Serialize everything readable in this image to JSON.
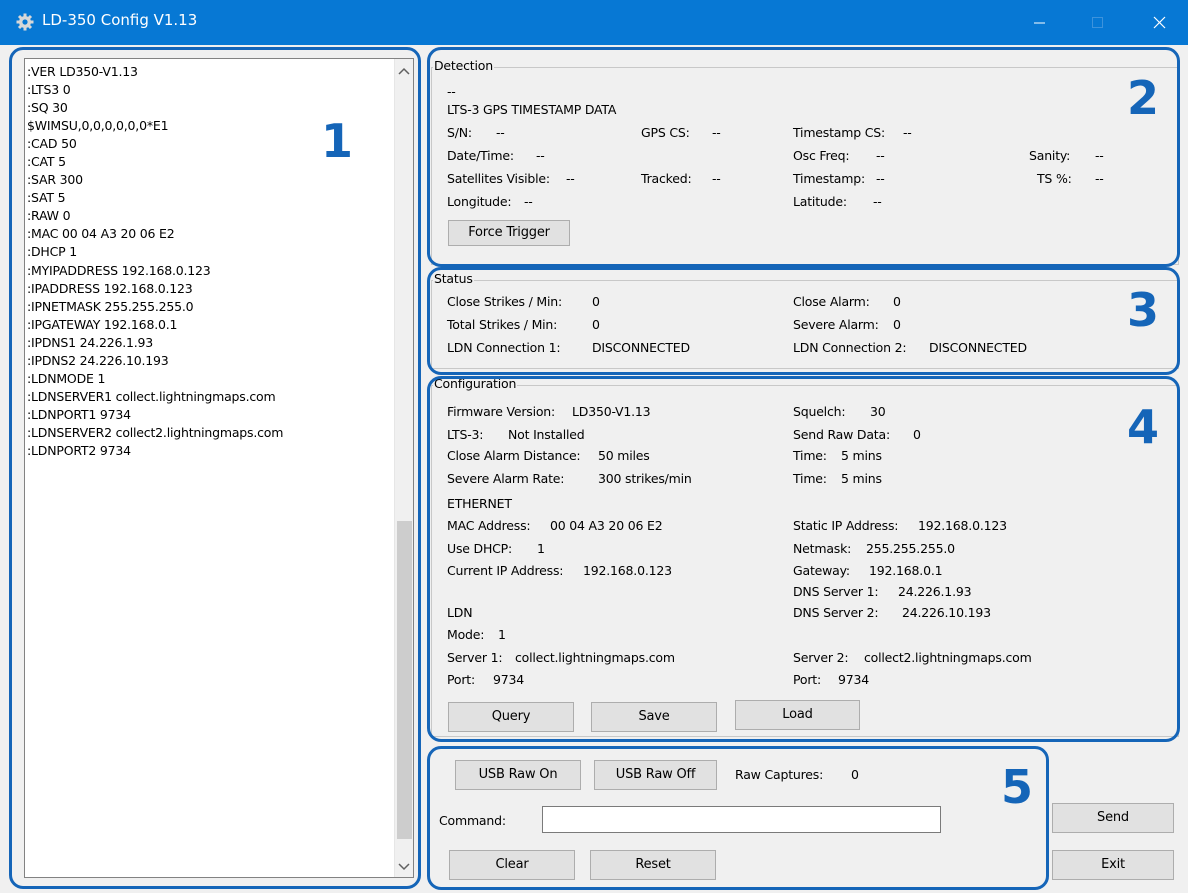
{
  "window": {
    "title": "LD-350 Config V1.13"
  },
  "colors": {
    "titlebar": "#0778d4",
    "annotation": "#1565b8"
  },
  "annotations": [
    "1",
    "2",
    "3",
    "4",
    "5"
  ],
  "log": {
    "lines": [
      ":VER LD350-V1.13",
      ":LTS3 0",
      ":SQ 30",
      "$WIMSU,0,0,0,0,0,0*E1",
      ":CAD 50",
      ":CAT 5",
      ":SAR 300",
      ":SAT 5",
      ":RAW 0",
      ":MAC 00 04 A3 20 06 E2",
      ":DHCP 1",
      ":MYIPADDRESS 192.168.0.123",
      ":IPADDRESS 192.168.0.123",
      ":IPNETMASK 255.255.255.0",
      ":IPGATEWAY 192.168.0.1",
      ":IPDNS1 24.226.1.93",
      ":IPDNS2 24.226.10.193",
      ":LDNMODE 1",
      ":LDNSERVER1 collect.lightningmaps.com",
      ":LDNPORT1 9734",
      ":LDNSERVER2 collect2.lightningmaps.com",
      ":LDNPORT2 9734"
    ]
  },
  "detection": {
    "group_title": "Detection",
    "dash": "--",
    "heading": "LTS-3 GPS TIMESTAMP DATA",
    "sn_label": "S/N:",
    "sn_value": "--",
    "gpscs_label": "GPS CS:",
    "gpscs_value": "--",
    "tscs_label": "Timestamp CS:",
    "tscs_value": "--",
    "datetime_label": "Date/Time:",
    "datetime_value": "--",
    "oscfreq_label": "Osc Freq:",
    "oscfreq_value": "--",
    "sanity_label": "Sanity:",
    "sanity_value": "--",
    "satvis_label": "Satellites Visible:",
    "satvis_value": "--",
    "tracked_label": "Tracked:",
    "tracked_value": "--",
    "timestamp_label": "Timestamp:",
    "timestamp_value": "--",
    "tspct_label": "TS %:",
    "tspct_value": "--",
    "longitude_label": "Longitude:",
    "longitude_value": "--",
    "latitude_label": "Latitude:",
    "latitude_value": "--",
    "force_trigger": "Force Trigger"
  },
  "status": {
    "group_title": "Status",
    "close_strikes_label": "Close Strikes / Min:",
    "close_strikes_value": "0",
    "total_strikes_label": "Total Strikes / Min:",
    "total_strikes_value": "0",
    "ldn1_label": "LDN Connection 1:",
    "ldn1_value": "DISCONNECTED",
    "close_alarm_label": "Close Alarm:",
    "close_alarm_value": "0",
    "severe_alarm_label": "Severe Alarm:",
    "severe_alarm_value": "0",
    "ldn2_label": "LDN Connection 2:",
    "ldn2_value": "DISCONNECTED"
  },
  "configuration": {
    "group_title": "Configuration",
    "fw_label": "Firmware Version:",
    "fw_value": "LD350-V1.13",
    "lts3_label": "LTS-3:",
    "lts3_value": "Not Installed",
    "cad_label": "Close Alarm Distance:",
    "cad_value": "50 miles",
    "sar_label": "Severe Alarm Rate:",
    "sar_value": "300 strikes/min",
    "squelch_label": "Squelch:",
    "squelch_value": "30",
    "raw_label": "Send Raw Data:",
    "raw_value": "0",
    "time1_label": "Time:",
    "time1_value": "5 mins",
    "time2_label": "Time:",
    "time2_value": "5 mins",
    "ethernet_heading": "ETHERNET",
    "mac_label": "MAC Address:",
    "mac_value": "00 04 A3 20 06 E2",
    "dhcp_label": "Use DHCP:",
    "dhcp_value": "1",
    "curip_label": "Current IP Address:",
    "curip_value": "192.168.0.123",
    "staticip_label": "Static IP Address:",
    "staticip_value": "192.168.0.123",
    "netmask_label": "Netmask:",
    "netmask_value": "255.255.255.0",
    "gateway_label": "Gateway:",
    "gateway_value": "192.168.0.1",
    "dns1_label": "DNS Server 1:",
    "dns1_value": "24.226.1.93",
    "dns2_label": "DNS Server 2:",
    "dns2_value": "24.226.10.193",
    "ldn_heading": "LDN",
    "mode_label": "Mode:",
    "mode_value": "1",
    "server1_label": "Server 1:",
    "server1_value": "collect.lightningmaps.com",
    "port1_label": "Port:",
    "port1_value": "9734",
    "server2_label": "Server 2:",
    "server2_value": "collect2.lightningmaps.com",
    "port2_label": "Port:",
    "port2_value": "9734",
    "query_button": "Query",
    "save_button": "Save",
    "load_button": "Load"
  },
  "bottom": {
    "usb_raw_on": "USB Raw On",
    "usb_raw_off": "USB Raw Off",
    "raw_captures_label": "Raw Captures:",
    "raw_captures_value": "0",
    "command_label": "Command:",
    "command_value": "",
    "clear_button": "Clear",
    "reset_button": "Reset",
    "send_button": "Send",
    "exit_button": "Exit"
  }
}
